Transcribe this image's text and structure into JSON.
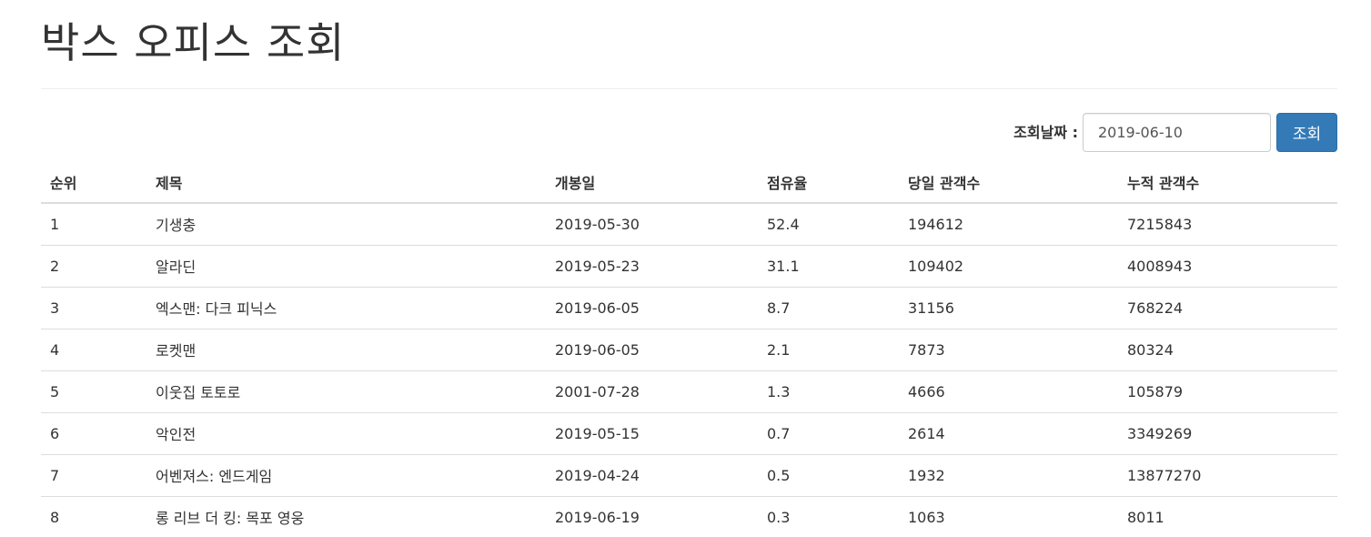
{
  "page": {
    "title": "박스 오피스 조회"
  },
  "search": {
    "label": "조회날짜 :",
    "date_value": "2019-06-10",
    "button_label": "조회"
  },
  "table": {
    "headers": {
      "rank": "순위",
      "title": "제목",
      "open_date": "개봉일",
      "share": "점유율",
      "daily_audience": "당일 관객수",
      "total_audience": "누적 관객수"
    },
    "rows": [
      {
        "rank": "1",
        "title": "기생충",
        "open_date": "2019-05-30",
        "share": "52.4",
        "daily_audience": "194612",
        "total_audience": "7215843"
      },
      {
        "rank": "2",
        "title": "알라딘",
        "open_date": "2019-05-23",
        "share": "31.1",
        "daily_audience": "109402",
        "total_audience": "4008943"
      },
      {
        "rank": "3",
        "title": "엑스맨: 다크 피닉스",
        "open_date": "2019-06-05",
        "share": "8.7",
        "daily_audience": "31156",
        "total_audience": "768224"
      },
      {
        "rank": "4",
        "title": "로켓맨",
        "open_date": "2019-06-05",
        "share": "2.1",
        "daily_audience": "7873",
        "total_audience": "80324"
      },
      {
        "rank": "5",
        "title": "이웃집 토토로",
        "open_date": "2001-07-28",
        "share": "1.3",
        "daily_audience": "4666",
        "total_audience": "105879"
      },
      {
        "rank": "6",
        "title": "악인전",
        "open_date": "2019-05-15",
        "share": "0.7",
        "daily_audience": "2614",
        "total_audience": "3349269"
      },
      {
        "rank": "7",
        "title": "어벤져스: 엔드게임",
        "open_date": "2019-04-24",
        "share": "0.5",
        "daily_audience": "1932",
        "total_audience": "13877270"
      },
      {
        "rank": "8",
        "title": "롱 리브 더 킹: 목포 영웅",
        "open_date": "2019-06-19",
        "share": "0.3",
        "daily_audience": "1063",
        "total_audience": "8011"
      }
    ]
  },
  "colors": {
    "primary_button": "#337ab7",
    "text": "#333333",
    "border": "#dddddd"
  }
}
